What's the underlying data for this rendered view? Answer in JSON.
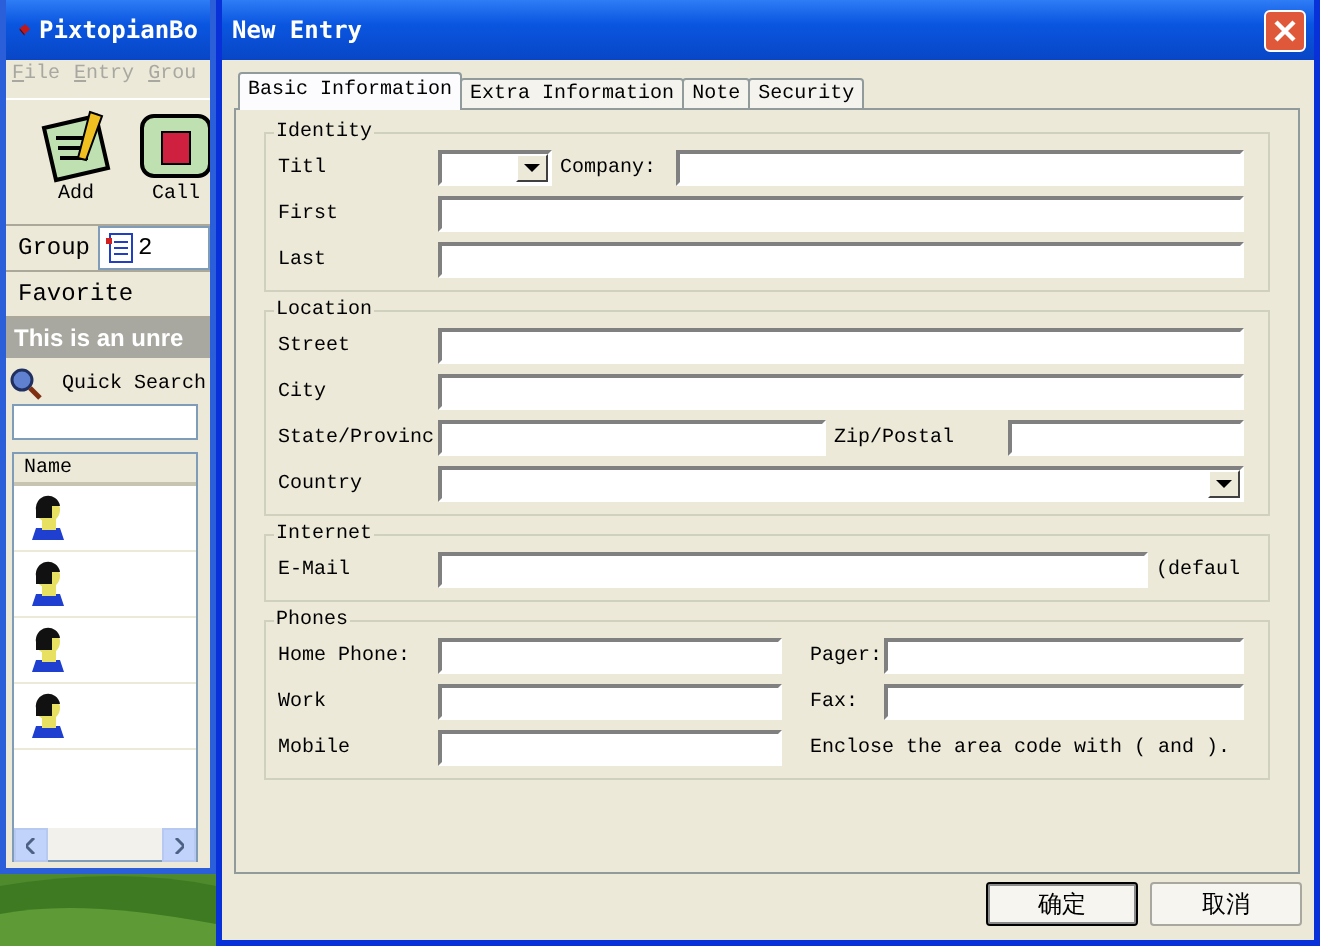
{
  "main_window": {
    "title": "PixtopianBo",
    "menu": [
      "File",
      "Entry",
      "Grou"
    ],
    "toolbar": [
      "Add",
      "Call"
    ],
    "group_label": "Group",
    "group_value": "2",
    "favorite": "Favorite",
    "banner": "This is an unre",
    "quick_search": "Quick Search",
    "list_header": "Name",
    "contacts": [
      {
        "kind": "person"
      },
      {
        "kind": "person"
      },
      {
        "kind": "person"
      },
      {
        "kind": "person"
      }
    ]
  },
  "dialog": {
    "title": "New Entry",
    "tabs": [
      {
        "label": "Basic Information",
        "selected": true
      },
      {
        "label": "Extra Information",
        "selected": false
      },
      {
        "label": "Note",
        "selected": false
      },
      {
        "label": "Security",
        "selected": false
      }
    ],
    "groups": [
      {
        "title": "Identity",
        "rows": [
          {
            "kind": "title-company",
            "label": "Titl",
            "label_2": "Company:"
          },
          {
            "kind": "single",
            "label": "First"
          },
          {
            "kind": "single",
            "label": "Last"
          }
        ]
      },
      {
        "title": "Location",
        "rows": [
          {
            "kind": "single",
            "label": "Street"
          },
          {
            "kind": "single",
            "label": "City"
          },
          {
            "kind": "state-zip",
            "label": "State/Provinc",
            "label_2": "Zip/Postal"
          },
          {
            "kind": "combo",
            "label": "Country"
          }
        ]
      },
      {
        "title": "Internet",
        "rows": [
          {
            "kind": "email",
            "label": "E-Mail",
            "note": "(defaul"
          }
        ]
      },
      {
        "title": "Phones",
        "rows": [
          {
            "kind": "phone-pair",
            "label": "Home Phone:",
            "label_2": "Pager:"
          },
          {
            "kind": "phone-pair",
            "label": "Work",
            "label_2": "Fax:"
          },
          {
            "kind": "phone-note",
            "label": "Mobile",
            "note": "Enclose the area code with ( and )."
          }
        ]
      }
    ],
    "buttons": [
      {
        "label": "确定",
        "default": true
      },
      {
        "label": "取消",
        "default": false
      }
    ]
  }
}
